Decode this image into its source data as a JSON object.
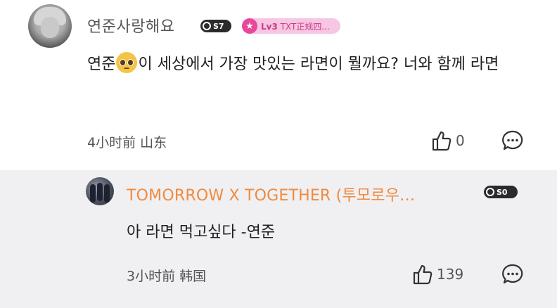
{
  "comment": {
    "username": "연준사랑해요",
    "level_badge": "S7",
    "member_badge": {
      "level": "Lv3",
      "text": "TXT正规四..."
    },
    "text_before_emoji": "연준",
    "emoji": "pleading-face-emoji",
    "text_after_emoji": "이 세상에서 가장 맛있는 라면이 뭘까요? 너와 함께 라면",
    "meta": "4小时前 山东",
    "like_count": "0"
  },
  "reply": {
    "username": "TOMORROW X TOGETHER (투모로우…",
    "level_badge": "S0",
    "text": "아 라면 먹고싶다 -연준",
    "meta": "3小时前 韩国",
    "like_count": "139"
  },
  "colors": {
    "reply_name": "#f08a3e",
    "member_badge_bg": "#f7c6e2",
    "member_badge_accent": "#e8479a",
    "reply_bg": "#f0f0f2"
  }
}
